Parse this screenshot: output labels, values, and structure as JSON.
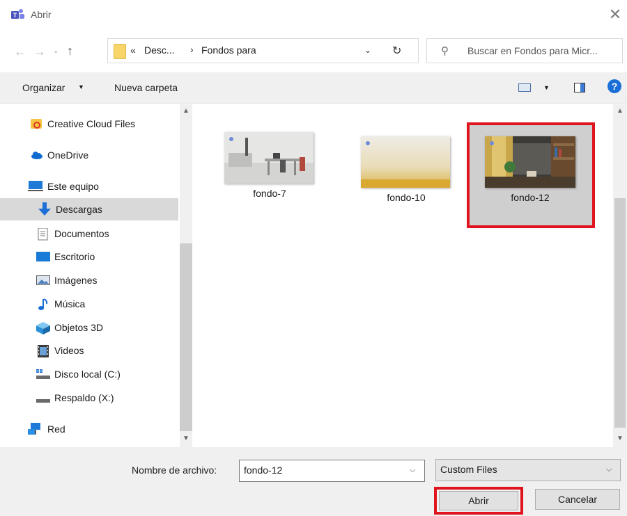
{
  "window": {
    "title": "Abrir",
    "close_glyph": "✕"
  },
  "nav": {
    "back_glyph": "←",
    "forward_glyph": "→",
    "recent_glyph": "⌄",
    "up_glyph": "↑",
    "address": {
      "chevrons": "«",
      "segments": [
        "Desc...",
        "Fondos para"
      ],
      "separator": "›",
      "dropdown_glyph": "⌄",
      "refresh_glyph": "↻"
    },
    "search": {
      "placeholder": "Buscar en Fondos para Micr...",
      "icon": "search-icon"
    }
  },
  "commandbar": {
    "organize_label": "Organizar",
    "new_folder_label": "Nueva carpeta",
    "help_glyph": "?"
  },
  "sidebar": {
    "items": [
      {
        "label": "Creative Cloud Files",
        "icon": "creative-cloud-icon"
      },
      {
        "label": "OneDrive",
        "icon": "cloud-icon"
      },
      {
        "label": "Este equipo",
        "icon": "computer-icon"
      },
      {
        "label": "Descargas",
        "icon": "download-icon",
        "selected": true
      },
      {
        "label": "Documentos",
        "icon": "document-icon"
      },
      {
        "label": "Escritorio",
        "icon": "desktop-icon"
      },
      {
        "label": "Imágenes",
        "icon": "pictures-icon"
      },
      {
        "label": "Música",
        "icon": "music-icon"
      },
      {
        "label": "Objetos 3D",
        "icon": "3d-objects-icon"
      },
      {
        "label": "Videos",
        "icon": "video-icon"
      },
      {
        "label": "Disco local (C:)",
        "icon": "drive-icon"
      },
      {
        "label": "Respaldo (X:)",
        "icon": "drive-icon"
      },
      {
        "label": "Red",
        "icon": "network-icon"
      }
    ]
  },
  "files": [
    {
      "name": "fondo-7",
      "selected": false
    },
    {
      "name": "fondo-10",
      "selected": false
    },
    {
      "name": "fondo-12",
      "selected": true
    }
  ],
  "footer": {
    "filename_label": "Nombre de archivo:",
    "filename_value": "fondo-12",
    "filter_value": "Custom Files",
    "open_label": "Abrir",
    "cancel_label": "Cancelar"
  },
  "colors": {
    "highlight": "#e0141e",
    "selection": "#d9d9d9",
    "accent": "#1a6fd6"
  }
}
